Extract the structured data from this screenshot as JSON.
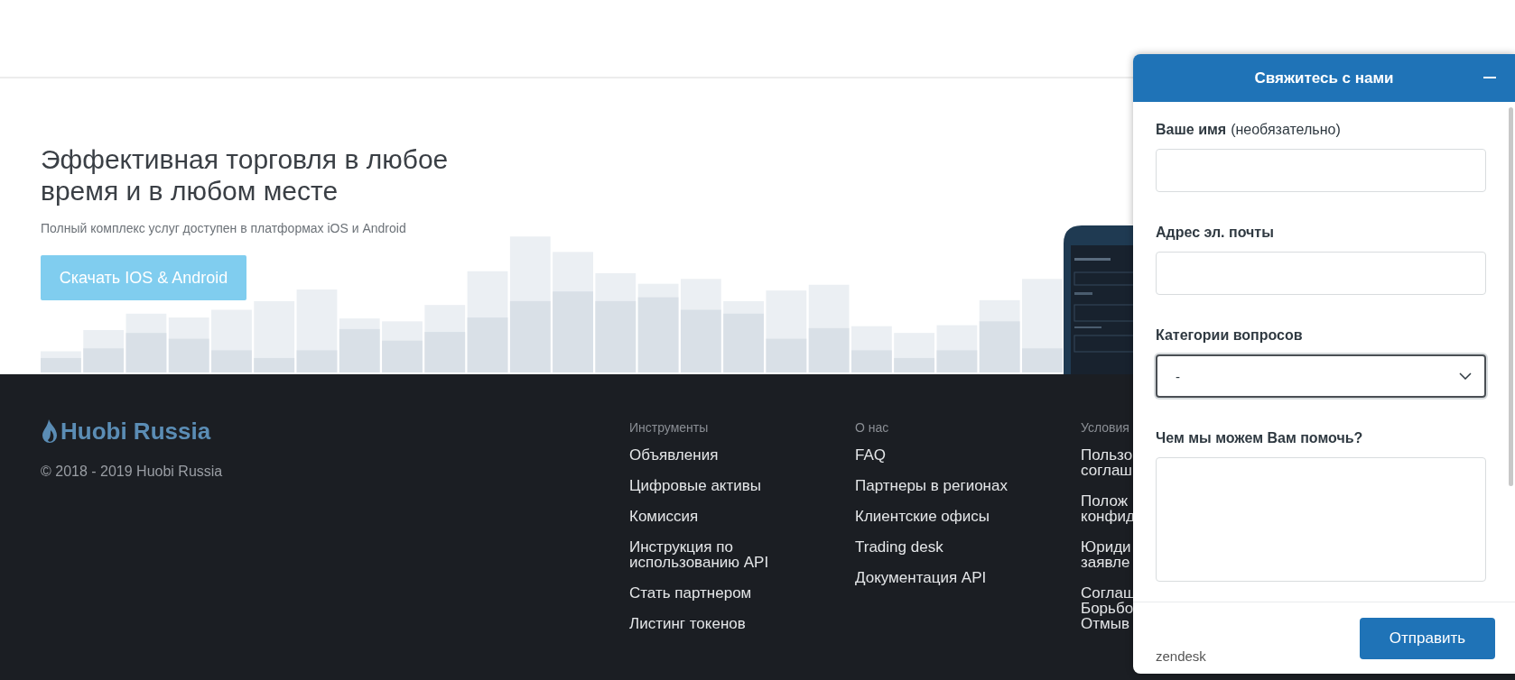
{
  "hero": {
    "title": "Эффективная торговля в любое время и в любом месте",
    "subtitle": "Полный комплекс услуг доступен в платформах iOS и Android",
    "button": "Скачать IOS & Android"
  },
  "footer": {
    "brand": "Huobi Russia",
    "copyright": "© 2018 - 2019 Huobi Russia",
    "columns": [
      {
        "heading": "Инструменты",
        "links": [
          [
            "Объявления"
          ],
          [
            "Цифровые активы"
          ],
          [
            "Комиссия"
          ],
          [
            "Инструкция по",
            "использованию API"
          ],
          [
            "Стать партнером"
          ],
          [
            "Листинг токенов"
          ]
        ]
      },
      {
        "heading": "О нас",
        "links": [
          [
            "FAQ"
          ],
          [
            "Партнеры в регионах"
          ],
          [
            "Клиентские офисы"
          ],
          [
            "Trading desk"
          ],
          [
            "Документация API"
          ]
        ]
      },
      {
        "heading": "Условия",
        "links": [
          [
            "Пользо",
            "соглаш"
          ],
          [
            "Полож",
            "конфид"
          ],
          [
            "Юриди",
            "заявле"
          ],
          [
            "Соглаш",
            "Борьбо",
            "Отмыв"
          ]
        ]
      }
    ]
  },
  "widget": {
    "title": "Свяжитесь с нами",
    "fields": [
      {
        "kind": "text",
        "label": "Ваше имя",
        "note": "(необязательно)"
      },
      {
        "kind": "text",
        "label": "Адрес эл. почты"
      },
      {
        "kind": "select",
        "label": "Категории вопросов",
        "value": "-"
      },
      {
        "kind": "textarea",
        "label": "Чем мы можем Вам помочь?"
      }
    ],
    "branding": "zendesk",
    "submit": "Отправить"
  }
}
